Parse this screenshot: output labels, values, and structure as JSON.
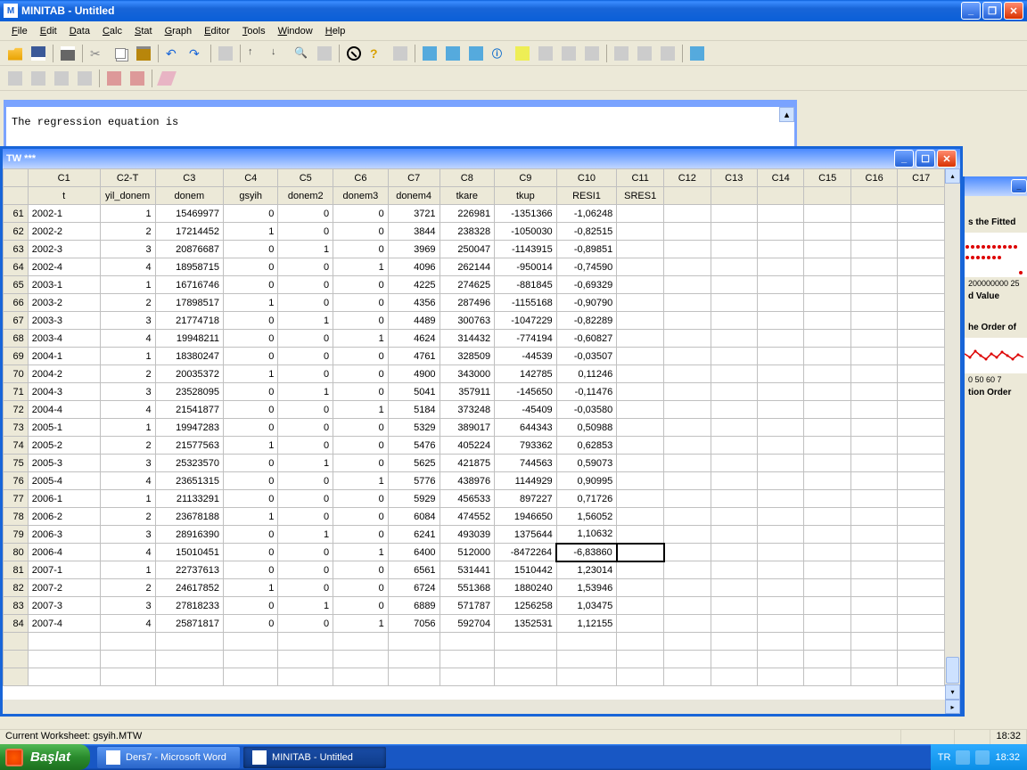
{
  "app": {
    "title": "MINITAB - Untitled",
    "icon_label": "M"
  },
  "menu": [
    "File",
    "Edit",
    "Data",
    "Calc",
    "Stat",
    "Graph",
    "Editor",
    "Tools",
    "Window",
    "Help"
  ],
  "session": {
    "text": "The regression equation is"
  },
  "worksheet": {
    "title": "TW ***",
    "columns_header1": [
      "C1",
      "C2-T",
      "C3",
      "C4",
      "C5",
      "C6",
      "C7",
      "C8",
      "C9",
      "C10",
      "C11",
      "C12",
      "C13",
      "C14",
      "C15",
      "C16",
      "C17"
    ],
    "columns_header2": [
      "t",
      "yil_donem",
      "donem",
      "gsyih",
      "donem2",
      "donem3",
      "donem4",
      "tkare",
      "tkup",
      "RESI1",
      "SRES1",
      "",
      "",
      "",
      "",
      "",
      ""
    ],
    "selected": {
      "row_index": 19,
      "col_index": 10
    },
    "rows": [
      {
        "n": 61,
        "c": [
          "2002-1",
          "1",
          "15469977",
          "0",
          "0",
          "0",
          "3721",
          "226981",
          "-1351366",
          "-1,06248"
        ]
      },
      {
        "n": 62,
        "c": [
          "2002-2",
          "2",
          "17214452",
          "1",
          "0",
          "0",
          "3844",
          "238328",
          "-1050030",
          "-0,82515"
        ]
      },
      {
        "n": 63,
        "c": [
          "2002-3",
          "3",
          "20876687",
          "0",
          "1",
          "0",
          "3969",
          "250047",
          "-1143915",
          "-0,89851"
        ]
      },
      {
        "n": 64,
        "c": [
          "2002-4",
          "4",
          "18958715",
          "0",
          "0",
          "1",
          "4096",
          "262144",
          "-950014",
          "-0,74590"
        ]
      },
      {
        "n": 65,
        "c": [
          "2003-1",
          "1",
          "16716746",
          "0",
          "0",
          "0",
          "4225",
          "274625",
          "-881845",
          "-0,69329"
        ]
      },
      {
        "n": 66,
        "c": [
          "2003-2",
          "2",
          "17898517",
          "1",
          "0",
          "0",
          "4356",
          "287496",
          "-1155168",
          "-0,90790"
        ]
      },
      {
        "n": 67,
        "c": [
          "2003-3",
          "3",
          "21774718",
          "0",
          "1",
          "0",
          "4489",
          "300763",
          "-1047229",
          "-0,82289"
        ]
      },
      {
        "n": 68,
        "c": [
          "2003-4",
          "4",
          "19948211",
          "0",
          "0",
          "1",
          "4624",
          "314432",
          "-774194",
          "-0,60827"
        ]
      },
      {
        "n": 69,
        "c": [
          "2004-1",
          "1",
          "18380247",
          "0",
          "0",
          "0",
          "4761",
          "328509",
          "-44539",
          "-0,03507"
        ]
      },
      {
        "n": 70,
        "c": [
          "2004-2",
          "2",
          "20035372",
          "1",
          "0",
          "0",
          "4900",
          "343000",
          "142785",
          "0,11246"
        ]
      },
      {
        "n": 71,
        "c": [
          "2004-3",
          "3",
          "23528095",
          "0",
          "1",
          "0",
          "5041",
          "357911",
          "-145650",
          "-0,11476"
        ]
      },
      {
        "n": 72,
        "c": [
          "2004-4",
          "4",
          "21541877",
          "0",
          "0",
          "1",
          "5184",
          "373248",
          "-45409",
          "-0,03580"
        ]
      },
      {
        "n": 73,
        "c": [
          "2005-1",
          "1",
          "19947283",
          "0",
          "0",
          "0",
          "5329",
          "389017",
          "644343",
          "0,50988"
        ]
      },
      {
        "n": 74,
        "c": [
          "2005-2",
          "2",
          "21577563",
          "1",
          "0",
          "0",
          "5476",
          "405224",
          "793362",
          "0,62853"
        ]
      },
      {
        "n": 75,
        "c": [
          "2005-3",
          "3",
          "25323570",
          "0",
          "1",
          "0",
          "5625",
          "421875",
          "744563",
          "0,59073"
        ]
      },
      {
        "n": 76,
        "c": [
          "2005-4",
          "4",
          "23651315",
          "0",
          "0",
          "1",
          "5776",
          "438976",
          "1144929",
          "0,90995"
        ]
      },
      {
        "n": 77,
        "c": [
          "2006-1",
          "1",
          "21133291",
          "0",
          "0",
          "0",
          "5929",
          "456533",
          "897227",
          "0,71726"
        ]
      },
      {
        "n": 78,
        "c": [
          "2006-2",
          "2",
          "23678188",
          "1",
          "0",
          "0",
          "6084",
          "474552",
          "1946650",
          "1,56052"
        ]
      },
      {
        "n": 79,
        "c": [
          "2006-3",
          "3",
          "28916390",
          "0",
          "1",
          "0",
          "6241",
          "493039",
          "1375644",
          "1,10632"
        ]
      },
      {
        "n": 80,
        "c": [
          "2006-4",
          "4",
          "15010451",
          "0",
          "0",
          "1",
          "6400",
          "512000",
          "-8472264",
          "-6,83860"
        ]
      },
      {
        "n": 81,
        "c": [
          "2007-1",
          "1",
          "22737613",
          "0",
          "0",
          "0",
          "6561",
          "531441",
          "1510442",
          "1,23014"
        ]
      },
      {
        "n": 82,
        "c": [
          "2007-2",
          "2",
          "24617852",
          "1",
          "0",
          "0",
          "6724",
          "551368",
          "1880240",
          "1,53946"
        ]
      },
      {
        "n": 83,
        "c": [
          "2007-3",
          "3",
          "27818233",
          "0",
          "1",
          "0",
          "6889",
          "571787",
          "1256258",
          "1,03475"
        ]
      },
      {
        "n": 84,
        "c": [
          "2007-4",
          "4",
          "25871817",
          "0",
          "0",
          "1",
          "7056",
          "592704",
          "1352531",
          "1,12155"
        ]
      }
    ]
  },
  "chart_strip": {
    "title1": "s the Fitted",
    "xlabel1": "d Value",
    "xticks1": "200000000  25",
    "title2": "he Order of",
    "xlabel2": "tion Order",
    "xticks2": "0   50   60   7"
  },
  "status": {
    "worksheet": "Current Worksheet: gsyih.MTW",
    "time": "18:32"
  },
  "taskbar": {
    "start": "Başlat",
    "items": [
      {
        "label": "Ders7 - Microsoft Word",
        "active": false
      },
      {
        "label": "MINITAB - Untitled",
        "active": true
      }
    ],
    "tray": {
      "lang": "TR",
      "clock": "18:32"
    }
  }
}
